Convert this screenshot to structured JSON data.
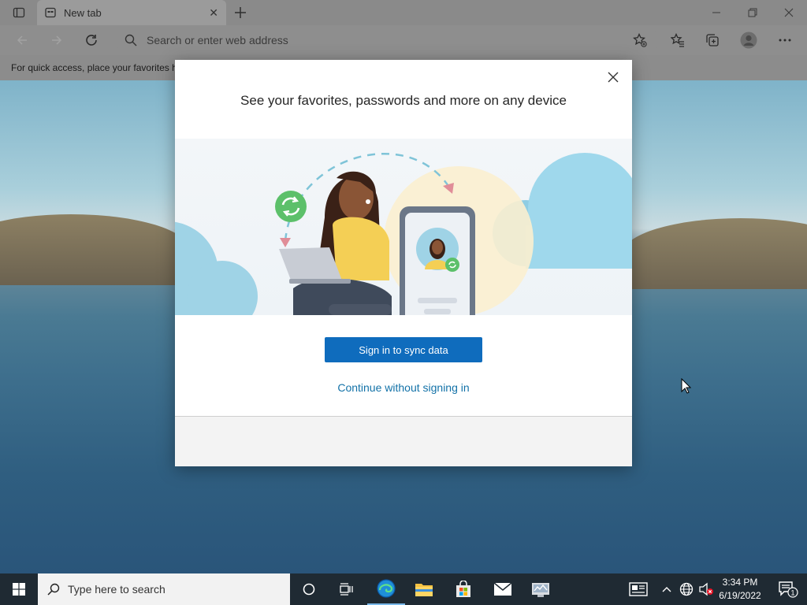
{
  "browser": {
    "tab_title": "New tab",
    "address_placeholder": "Search or enter web address",
    "favbar_text": "For quick access, place your favorites h"
  },
  "dialog": {
    "title": "See your favorites, passwords and more on any device",
    "sign_in_label": "Sign in to sync data",
    "continue_label": "Continue without signing in"
  },
  "taskbar": {
    "search_placeholder": "Type here to search",
    "time": "3:34 PM",
    "date": "6/19/2022",
    "notification_count": "1"
  },
  "colors": {
    "accent": "#0f6cbd",
    "link": "#1372a8",
    "taskbar": "#1f2a33"
  }
}
